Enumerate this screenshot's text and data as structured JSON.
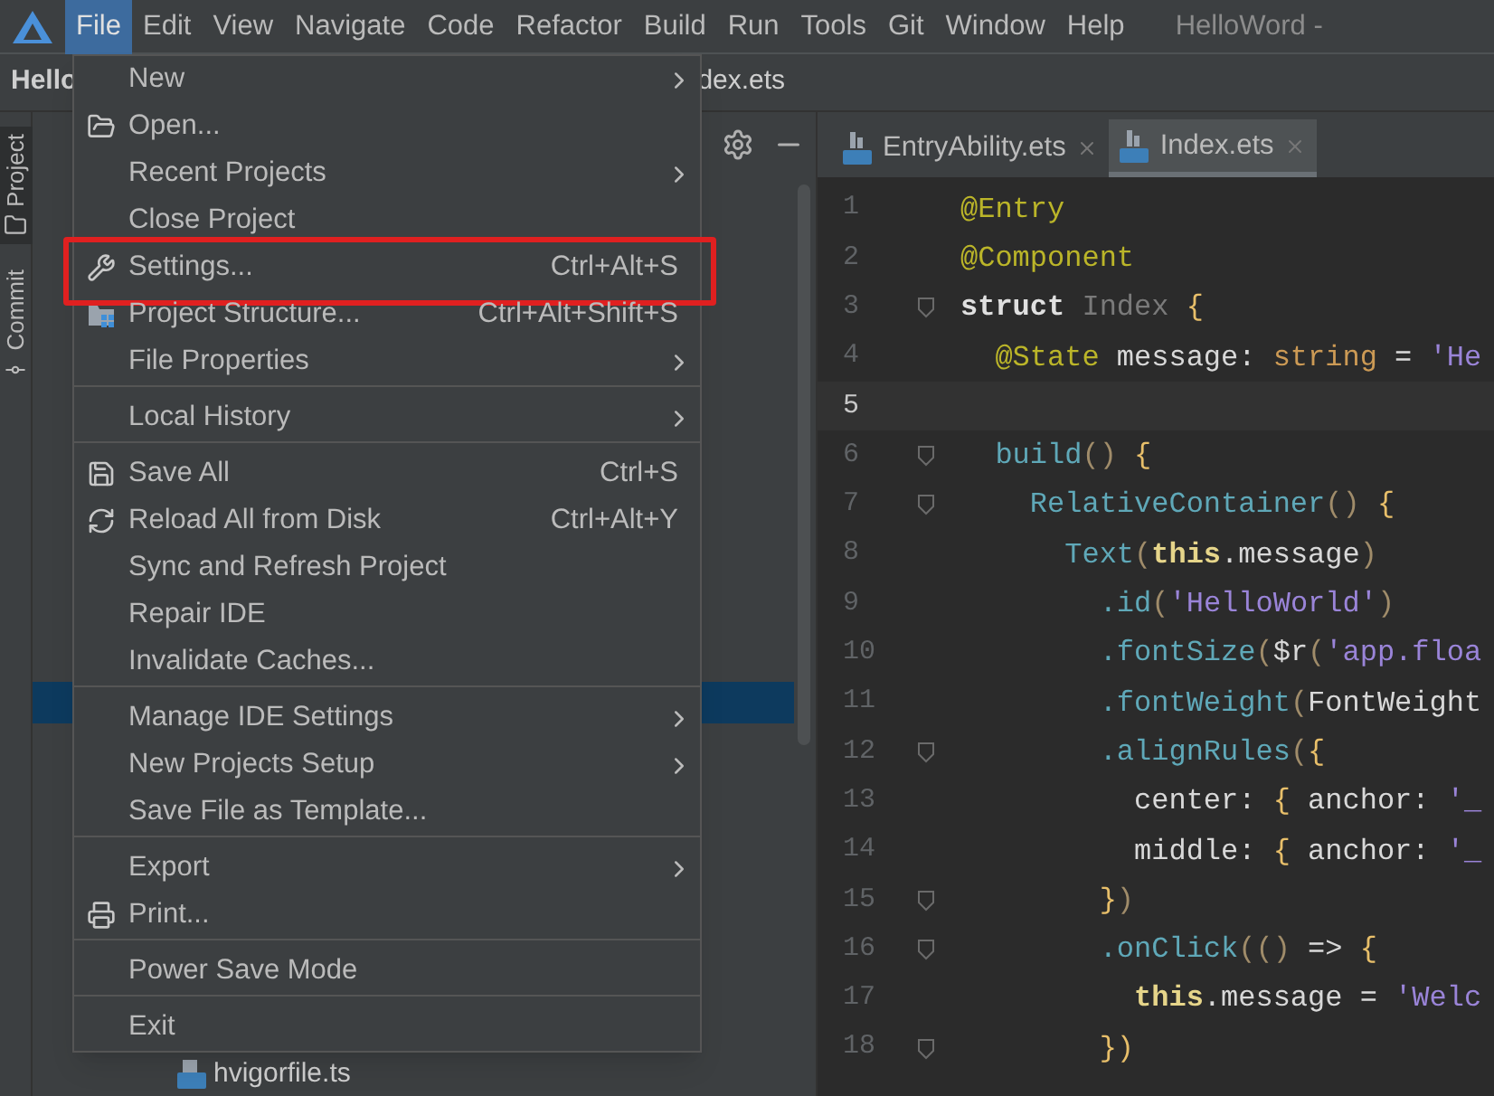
{
  "menu_bar": {
    "items": [
      {
        "label": "File",
        "selected": true
      },
      {
        "label": "Edit",
        "selected": false
      },
      {
        "label": "View",
        "selected": false
      },
      {
        "label": "Navigate",
        "selected": false
      },
      {
        "label": "Code",
        "selected": false
      },
      {
        "label": "Refactor",
        "selected": false
      },
      {
        "label": "Build",
        "selected": false
      },
      {
        "label": "Run",
        "selected": false
      },
      {
        "label": "Tools",
        "selected": false
      },
      {
        "label": "Git",
        "selected": false
      },
      {
        "label": "Window",
        "selected": false
      },
      {
        "label": "Help",
        "selected": false
      }
    ],
    "title": "HelloWord -"
  },
  "nav_bar": {
    "project": "Hello",
    "file": "dex.ets"
  },
  "tool_strip": [
    {
      "label": "Project",
      "selected": true
    },
    {
      "label": "Commit",
      "selected": false
    }
  ],
  "project_tree": {
    "items": [
      {
        "label": "hvigorfile.ts",
        "selected": false
      }
    ]
  },
  "tabs": [
    {
      "label": "EntryAbility.ets",
      "selected": false
    },
    {
      "label": "Index.ets",
      "selected": true
    }
  ],
  "file_menu": [
    {
      "kind": "item",
      "label": "New",
      "submenu": true
    },
    {
      "kind": "item",
      "label": "Open..."
    },
    {
      "kind": "item",
      "label": "Recent Projects",
      "submenu": true
    },
    {
      "kind": "item",
      "label": "Close Project"
    },
    {
      "kind": "item",
      "label": "Settings...",
      "shortcut": "Ctrl+Alt+S",
      "highlighted": true
    },
    {
      "kind": "item",
      "label": "Project Structure...",
      "shortcut": "Ctrl+Alt+Shift+S"
    },
    {
      "kind": "item",
      "label": "File Properties",
      "submenu": true
    },
    {
      "kind": "separator"
    },
    {
      "kind": "item",
      "label": "Local History",
      "submenu": true
    },
    {
      "kind": "separator"
    },
    {
      "kind": "item",
      "label": "Save All",
      "shortcut": "Ctrl+S"
    },
    {
      "kind": "item",
      "label": "Reload All from Disk",
      "shortcut": "Ctrl+Alt+Y"
    },
    {
      "kind": "item",
      "label": "Sync and Refresh Project"
    },
    {
      "kind": "item",
      "label": "Repair IDE"
    },
    {
      "kind": "item",
      "label": "Invalidate Caches..."
    },
    {
      "kind": "separator"
    },
    {
      "kind": "item",
      "label": "Manage IDE Settings",
      "submenu": true
    },
    {
      "kind": "item",
      "label": "New Projects Setup",
      "submenu": true
    },
    {
      "kind": "item",
      "label": "Save File as Template..."
    },
    {
      "kind": "separator"
    },
    {
      "kind": "item",
      "label": "Export",
      "submenu": true
    },
    {
      "kind": "item",
      "label": "Print..."
    },
    {
      "kind": "separator"
    },
    {
      "kind": "item",
      "label": "Power Save Mode"
    },
    {
      "kind": "separator"
    },
    {
      "kind": "item",
      "label": "Exit"
    }
  ],
  "code_lines": [
    {
      "number": "1",
      "fold": false,
      "current": false,
      "tokens": [
        {
          "t": "@Entry",
          "kind": "annotation"
        }
      ]
    },
    {
      "number": "2",
      "fold": false,
      "current": false,
      "tokens": [
        {
          "t": "@Component",
          "kind": "annotation"
        }
      ]
    },
    {
      "number": "3",
      "fold": true,
      "current": false,
      "tokens": [
        {
          "t": "struct",
          "kind": "keyword"
        },
        {
          "t": " Index",
          "kind": "dim"
        },
        {
          "t": " {",
          "kind": "brace"
        }
      ]
    },
    {
      "number": "4",
      "fold": false,
      "current": false,
      "tokens": [
        {
          "t": "  @State",
          "kind": "annotation"
        },
        {
          "t": " message: ",
          "kind": "plain"
        },
        {
          "t": "string",
          "kind": "type"
        },
        {
          "t": " = ",
          "kind": "plain"
        },
        {
          "t": "'He",
          "kind": "string"
        }
      ]
    },
    {
      "number": "5",
      "fold": false,
      "current": true
    },
    {
      "number": "6",
      "fold": true,
      "current": false,
      "tokens": [
        {
          "t": "  build",
          "kind": "func"
        },
        {
          "t": "()",
          "kind": "paren"
        },
        {
          "t": " {",
          "kind": "brace"
        }
      ]
    },
    {
      "number": "7",
      "fold": true,
      "current": false,
      "tokens": [
        {
          "t": "    RelativeContainer",
          "kind": "func"
        },
        {
          "t": "()",
          "kind": "paren"
        },
        {
          "t": " {",
          "kind": "brace"
        }
      ]
    },
    {
      "number": "8",
      "fold": false,
      "current": false,
      "tokens": [
        {
          "t": "      Text",
          "kind": "func"
        },
        {
          "t": "(",
          "kind": "paren"
        },
        {
          "t": "this",
          "kind": "this"
        },
        {
          "t": ".message",
          "kind": "plain"
        },
        {
          "t": ")",
          "kind": "paren"
        }
      ]
    },
    {
      "number": "9",
      "fold": false,
      "current": false,
      "tokens": [
        {
          "t": "        .id",
          "kind": "func"
        },
        {
          "t": "(",
          "kind": "paren"
        },
        {
          "t": "'HelloWorld'",
          "kind": "string"
        },
        {
          "t": ")",
          "kind": "paren"
        }
      ]
    },
    {
      "number": "10",
      "fold": false,
      "current": false,
      "tokens": [
        {
          "t": "        .fontSize",
          "kind": "func"
        },
        {
          "t": "(",
          "kind": "paren"
        },
        {
          "t": "$r",
          "kind": "plain"
        },
        {
          "t": "(",
          "kind": "paren"
        },
        {
          "t": "'app.floa",
          "kind": "string"
        }
      ]
    },
    {
      "number": "11",
      "fold": false,
      "current": false,
      "tokens": [
        {
          "t": "        .fontWeight",
          "kind": "func"
        },
        {
          "t": "(",
          "kind": "paren"
        },
        {
          "t": "FontWeight",
          "kind": "plain"
        }
      ]
    },
    {
      "number": "12",
      "fold": true,
      "current": false,
      "tokens": [
        {
          "t": "        .alignRules",
          "kind": "func"
        },
        {
          "t": "(",
          "kind": "paren"
        },
        {
          "t": "{",
          "kind": "brace"
        }
      ]
    },
    {
      "number": "13",
      "fold": false,
      "current": false,
      "tokens": [
        {
          "t": "          center: ",
          "kind": "plain"
        },
        {
          "t": "{",
          "kind": "brace"
        },
        {
          "t": " anchor: ",
          "kind": "plain"
        },
        {
          "t": "'_",
          "kind": "string"
        }
      ]
    },
    {
      "number": "14",
      "fold": false,
      "current": false,
      "tokens": [
        {
          "t": "          middle: ",
          "kind": "plain"
        },
        {
          "t": "{",
          "kind": "brace"
        },
        {
          "t": " anchor: ",
          "kind": "plain"
        },
        {
          "t": "'_",
          "kind": "string"
        }
      ]
    },
    {
      "number": "15",
      "fold": true,
      "current": false,
      "tokens": [
        {
          "t": "        }",
          "kind": "brace"
        },
        {
          "t": ")",
          "kind": "paren"
        }
      ]
    },
    {
      "number": "16",
      "fold": true,
      "current": false,
      "tokens": [
        {
          "t": "        .onClick",
          "kind": "func"
        },
        {
          "t": "(",
          "kind": "paren"
        },
        {
          "t": "()",
          "kind": "paren"
        },
        {
          "t": " => ",
          "kind": "plain"
        },
        {
          "t": "{",
          "kind": "brace"
        }
      ]
    },
    {
      "number": "17",
      "fold": false,
      "current": false,
      "tokens": [
        {
          "t": "          this",
          "kind": "this"
        },
        {
          "t": ".message = ",
          "kind": "plain"
        },
        {
          "t": "'Welc",
          "kind": "string"
        }
      ]
    },
    {
      "number": "18",
      "fold": true,
      "current": false,
      "tokens": [
        {
          "t": "        })",
          "kind": "brace"
        }
      ]
    }
  ]
}
